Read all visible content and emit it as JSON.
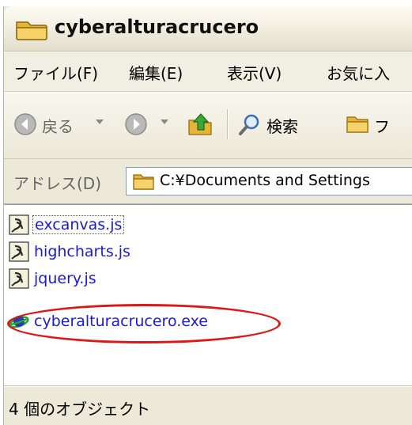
{
  "window": {
    "title": "cyberalturacrucero"
  },
  "menu": {
    "items": [
      {
        "label": "ファイル(F)"
      },
      {
        "label": "編集(E)"
      },
      {
        "label": "表示(V)"
      },
      {
        "label": "お気に入"
      }
    ]
  },
  "toolbar": {
    "back_label": "戻る",
    "search_label": "検索",
    "folders_label": "フ"
  },
  "address": {
    "label": "アドレス(D)",
    "path": "C:¥Documents and Settings"
  },
  "files": [
    {
      "name": "excanvas.js",
      "type": "script"
    },
    {
      "name": "highcharts.js",
      "type": "script"
    },
    {
      "name": "jquery.js",
      "type": "script"
    },
    {
      "name": "cyberalturacrucero.exe",
      "type": "executable"
    }
  ],
  "status": {
    "text": "4 個のオブジェクト"
  },
  "colors": {
    "highlight_ring": "#e01616",
    "link_text": "#1a1ad6",
    "chrome": "#ece9d8"
  }
}
